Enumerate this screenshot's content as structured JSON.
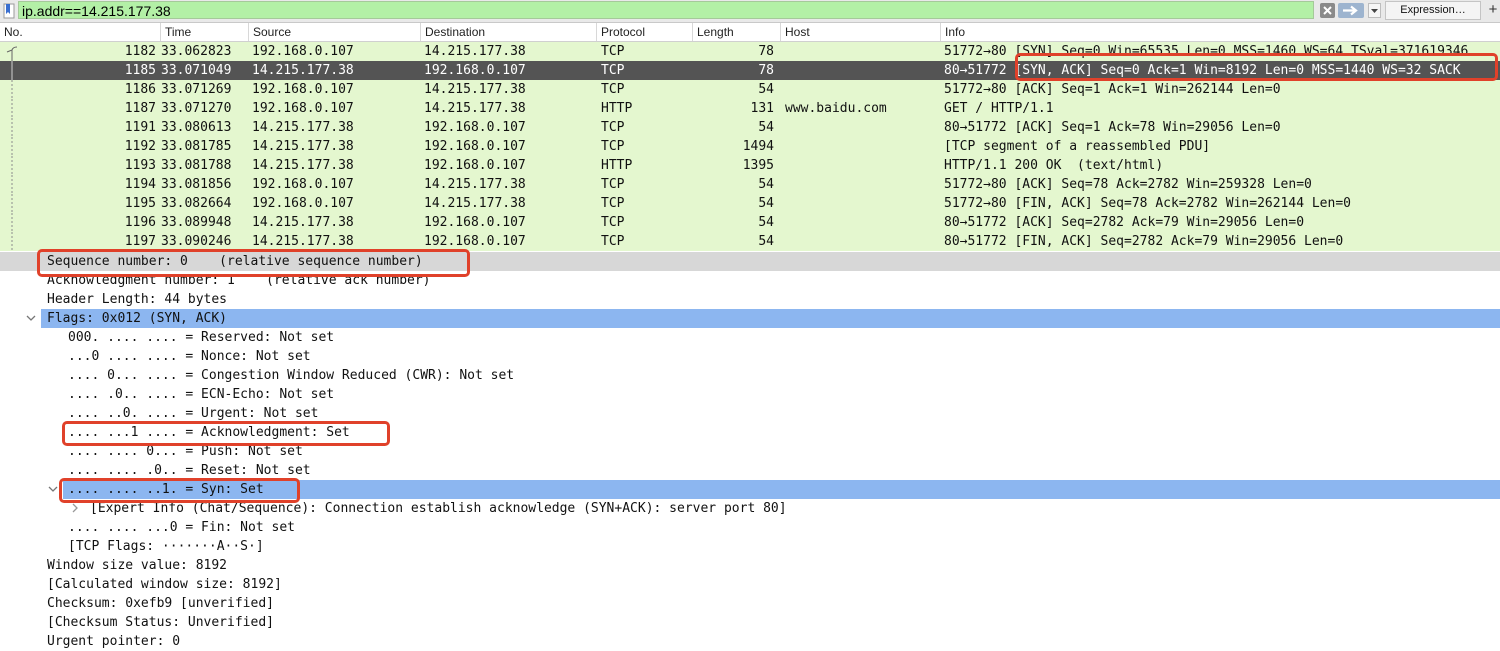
{
  "filter": {
    "value": "ip.addr==14.215.177.38",
    "expression_label": "Expression…",
    "plus_label": "+"
  },
  "packet_list": {
    "columns": [
      "No.",
      "Time",
      "Source",
      "Destination",
      "Protocol",
      "Length",
      "Host",
      "Info"
    ],
    "rows": [
      {
        "no": "1182",
        "time": "33.062823",
        "src": "192.168.0.107",
        "dst": "14.215.177.38",
        "proto": "TCP",
        "len": "78",
        "host": "",
        "info": "51772→80 [SYN] Seq=0 Win=65535 Len=0 MSS=1460 WS=64 TSval=371619346"
      },
      {
        "no": "1185",
        "time": "33.071049",
        "src": "14.215.177.38",
        "dst": "192.168.0.107",
        "proto": "TCP",
        "len": "78",
        "host": "",
        "info": "80→51772 [SYN, ACK] Seq=0 Ack=1 Win=8192 Len=0 MSS=1440 WS=32 SACK"
      },
      {
        "no": "1186",
        "time": "33.071269",
        "src": "192.168.0.107",
        "dst": "14.215.177.38",
        "proto": "TCP",
        "len": "54",
        "host": "",
        "info": "51772→80 [ACK] Seq=1 Ack=1 Win=262144 Len=0"
      },
      {
        "no": "1187",
        "time": "33.071270",
        "src": "192.168.0.107",
        "dst": "14.215.177.38",
        "proto": "HTTP",
        "len": "131",
        "host": "www.baidu.com",
        "info": "GET / HTTP/1.1"
      },
      {
        "no": "1191",
        "time": "33.080613",
        "src": "14.215.177.38",
        "dst": "192.168.0.107",
        "proto": "TCP",
        "len": "54",
        "host": "",
        "info": "80→51772 [ACK] Seq=1 Ack=78 Win=29056 Len=0"
      },
      {
        "no": "1192",
        "time": "33.081785",
        "src": "14.215.177.38",
        "dst": "192.168.0.107",
        "proto": "TCP",
        "len": "1494",
        "host": "",
        "info": "[TCP segment of a reassembled PDU]"
      },
      {
        "no": "1193",
        "time": "33.081788",
        "src": "14.215.177.38",
        "dst": "192.168.0.107",
        "proto": "HTTP",
        "len": "1395",
        "host": "",
        "info": "HTTP/1.1 200 OK  (text/html)"
      },
      {
        "no": "1194",
        "time": "33.081856",
        "src": "192.168.0.107",
        "dst": "14.215.177.38",
        "proto": "TCP",
        "len": "54",
        "host": "",
        "info": "51772→80 [ACK] Seq=78 Ack=2782 Win=259328 Len=0"
      },
      {
        "no": "1195",
        "time": "33.082664",
        "src": "192.168.0.107",
        "dst": "14.215.177.38",
        "proto": "TCP",
        "len": "54",
        "host": "",
        "info": "51772→80 [FIN, ACK] Seq=78 Ack=2782 Win=262144 Len=0"
      },
      {
        "no": "1196",
        "time": "33.089948",
        "src": "14.215.177.38",
        "dst": "192.168.0.107",
        "proto": "TCP",
        "len": "54",
        "host": "",
        "info": "80→51772 [ACK] Seq=2782 Ack=79 Win=29056 Len=0"
      },
      {
        "no": "1197",
        "time": "33.090246",
        "src": "14.215.177.38",
        "dst": "192.168.0.107",
        "proto": "TCP",
        "len": "54",
        "host": "",
        "info": "80→51772 [FIN, ACK] Seq=2782 Ack=79 Win=29056 Len=0"
      }
    ]
  },
  "details": {
    "lines": [
      "Sequence number: 0    (relative sequence number)",
      "Acknowledgment number: 1    (relative ack number)",
      "Header Length: 44 bytes",
      "Flags: 0x012 (SYN, ACK)",
      "000. .... .... = Reserved: Not set",
      "...0 .... .... = Nonce: Not set",
      ".... 0... .... = Congestion Window Reduced (CWR): Not set",
      ".... .0.. .... = ECN-Echo: Not set",
      ".... ..0. .... = Urgent: Not set",
      ".... ...1 .... = Acknowledgment: Set",
      ".... .... 0... = Push: Not set",
      ".... .... .0.. = Reset: Not set",
      ".... .... ..1. = Syn: Set",
      "[Expert Info (Chat/Sequence): Connection establish acknowledge (SYN+ACK): server port 80]",
      ".... .... ...0 = Fin: Not set",
      "[TCP Flags: ·······A··S·]",
      "Window size value: 8192",
      "[Calculated window size: 8192]",
      "Checksum: 0xefb9 [unverified]",
      "[Checksum Status: Unverified]",
      "Urgent pointer: 0"
    ]
  },
  "colors": {
    "row_bg": "#e4f7cf",
    "selected_row_bg": "#545454",
    "filter_bg": "#b3f0a6",
    "highlight_blue": "#8cb6f0",
    "callout_red": "#e0412a"
  }
}
